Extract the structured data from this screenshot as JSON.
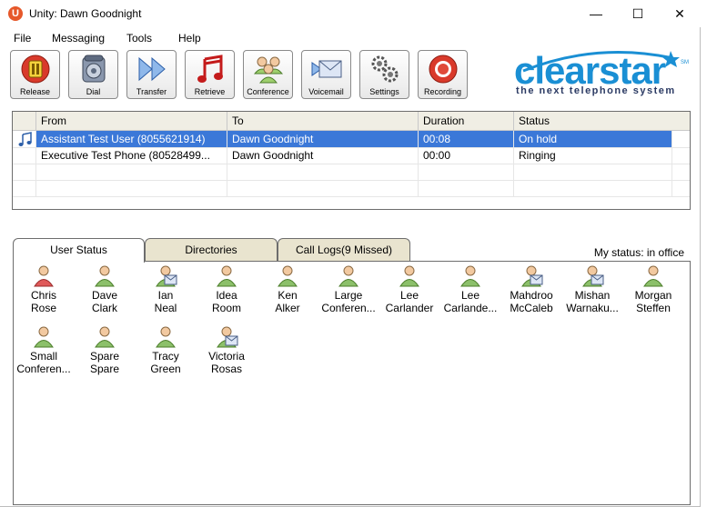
{
  "window": {
    "title": "Unity: Dawn Goodnight",
    "app_icon": "U"
  },
  "window_controls": {
    "minimize": "—",
    "maximize": "☐",
    "close": "✕"
  },
  "menu": [
    "File",
    "Messaging",
    "Tools",
    "Help"
  ],
  "toolbar": [
    {
      "label": "Release",
      "icon": "release-icon"
    },
    {
      "label": "Dial",
      "icon": "phone-icon"
    },
    {
      "label": "Transfer",
      "icon": "transfer-icon"
    },
    {
      "label": "Retrieve",
      "icon": "music-note-icon"
    },
    {
      "label": "Conference",
      "icon": "conference-icon"
    },
    {
      "label": "Voicemail",
      "icon": "voicemail-icon"
    },
    {
      "label": "Settings",
      "icon": "gear-icon"
    },
    {
      "label": "Recording",
      "icon": "record-icon"
    }
  ],
  "logo": {
    "main": "clearstar",
    "tagline": "the next telephone system",
    "mark": "SM"
  },
  "calls": {
    "columns": [
      "From",
      "To",
      "Duration",
      "Status"
    ],
    "rows": [
      {
        "from": "Assistant Test User (8055621914)",
        "to": "Dawn Goodnight",
        "duration": "00:08",
        "status": "On hold",
        "selected": true
      },
      {
        "from": "Executive Test Phone (80528499...",
        "to": "Dawn Goodnight",
        "duration": "00:00",
        "status": "Ringing",
        "selected": false
      }
    ]
  },
  "tabs": [
    "User Status",
    "Directories",
    "Call Logs(9 Missed)"
  ],
  "my_status": "My status: in office",
  "users": [
    {
      "line1": "Chris",
      "line2": "Rose",
      "state": "busy"
    },
    {
      "line1": "Dave",
      "line2": "Clark",
      "state": "available"
    },
    {
      "line1": "Ian",
      "line2": "Neal",
      "state": "voicemail"
    },
    {
      "line1": "Idea",
      "line2": "Room",
      "state": "available"
    },
    {
      "line1": "Ken",
      "line2": "Alker",
      "state": "available"
    },
    {
      "line1": "Large",
      "line2": "Conferen...",
      "state": "available"
    },
    {
      "line1": "Lee",
      "line2": "Carlander",
      "state": "available"
    },
    {
      "line1": "Lee",
      "line2": "Carlande...",
      "state": "available"
    },
    {
      "line1": "Mahdroo",
      "line2": "McCaleb",
      "state": "voicemail"
    },
    {
      "line1": "Mishan",
      "line2": "Warnaku...",
      "state": "voicemail"
    },
    {
      "line1": "Morgan",
      "line2": "Steffen",
      "state": "available"
    },
    {
      "line1": "Small",
      "line2": "Conferen...",
      "state": "available"
    },
    {
      "line1": "Spare",
      "line2": "Spare",
      "state": "available"
    },
    {
      "line1": "Tracy",
      "line2": "Green",
      "state": "available"
    },
    {
      "line1": "Victoria",
      "line2": "Rosas",
      "state": "voicemail"
    }
  ],
  "colors": {
    "selection": "#3b78d8",
    "tab_inactive": "#e9e4cf",
    "header": "#f0eee4",
    "logo_blue": "#1a8fd4",
    "busy": "#e05a5a",
    "available": "#8cc06a"
  }
}
